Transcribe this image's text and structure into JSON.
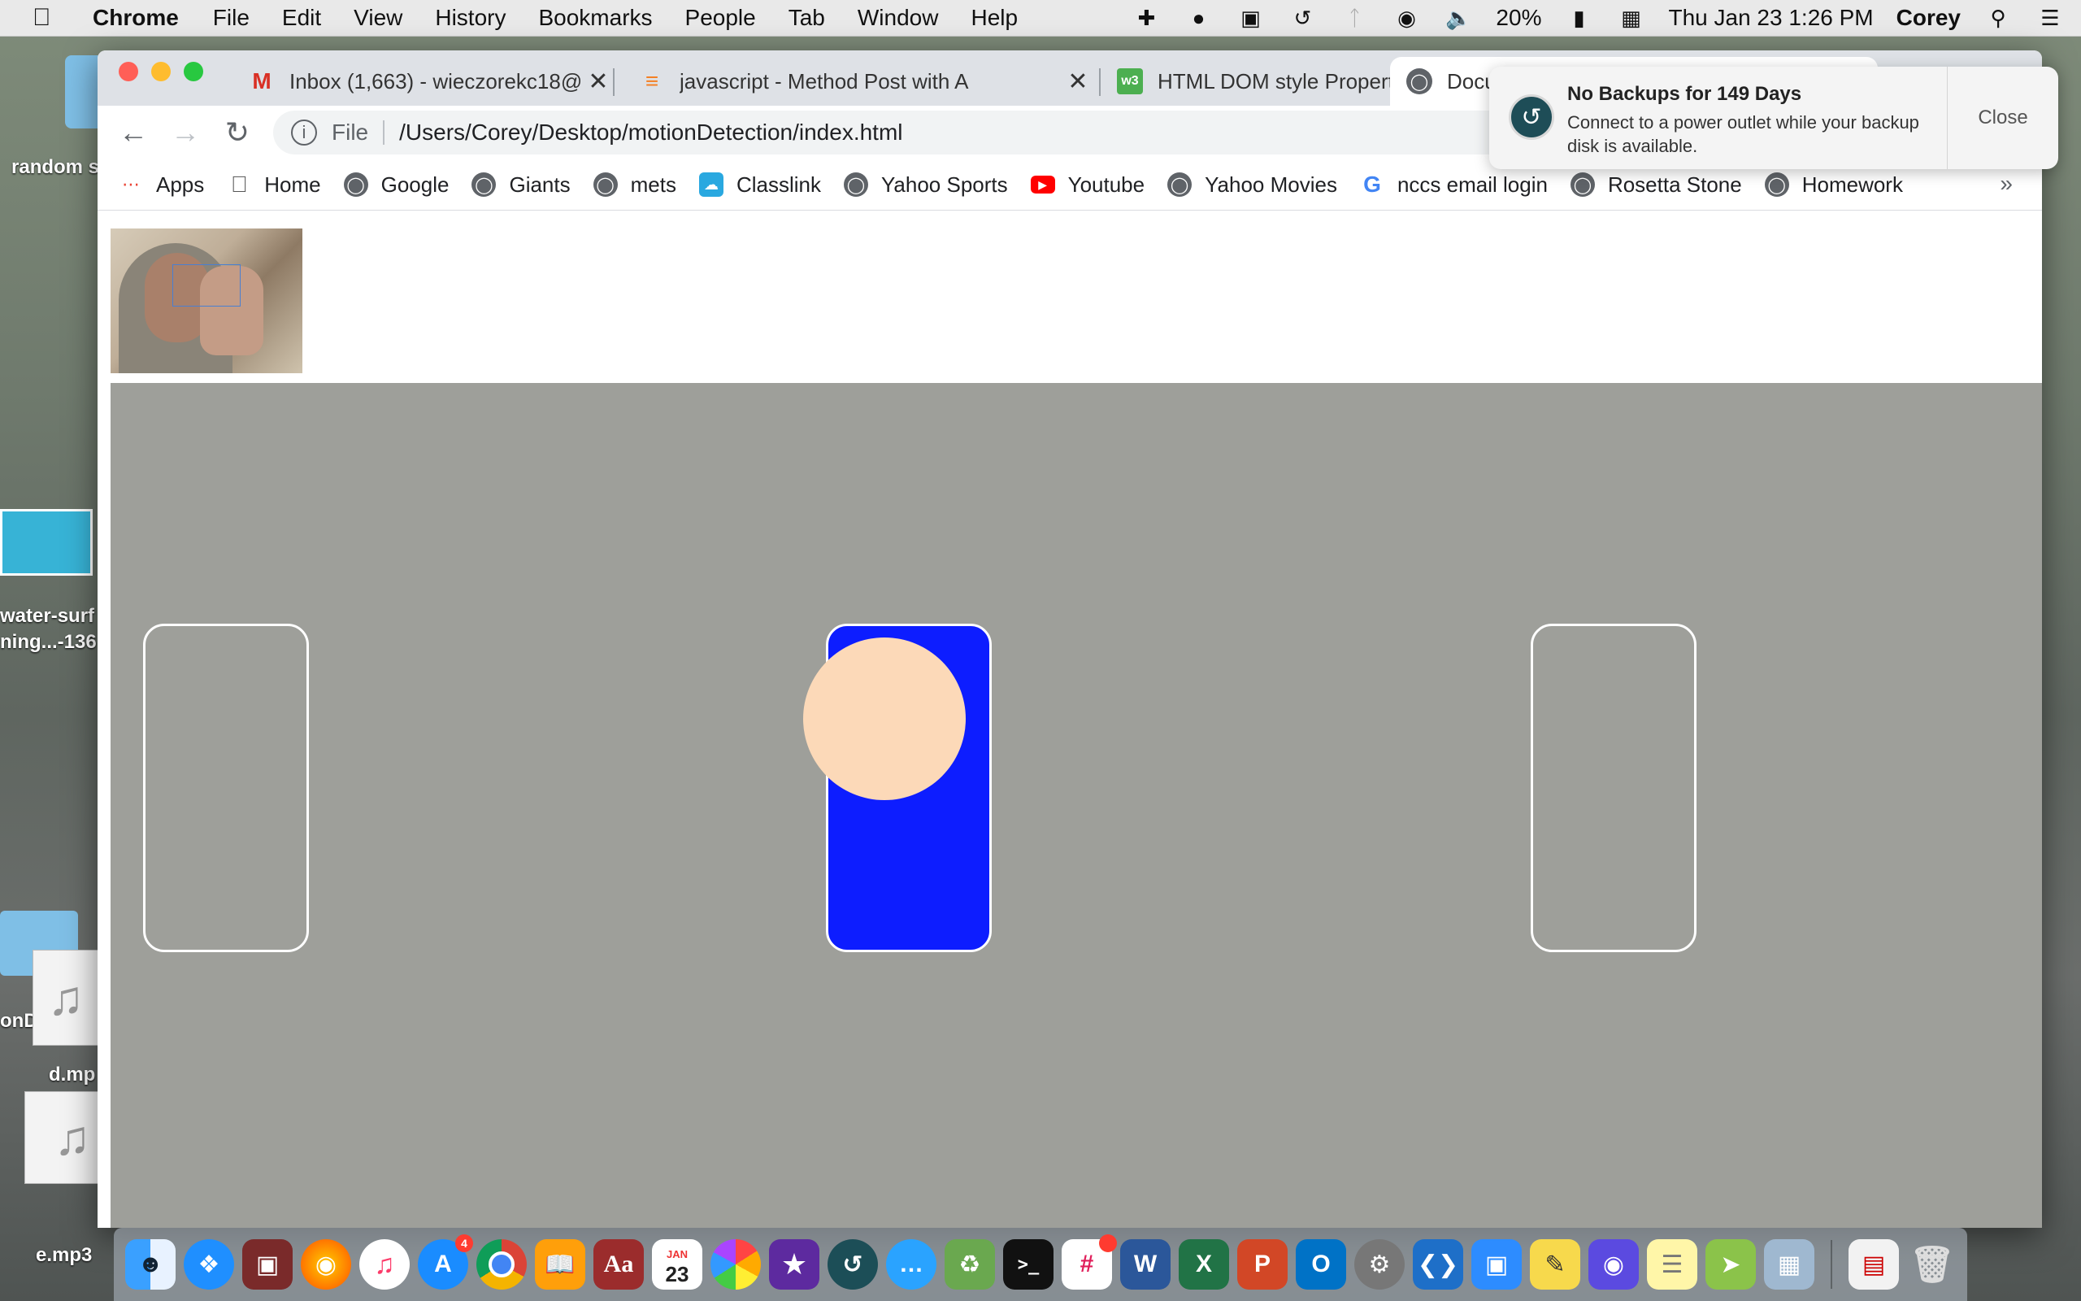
{
  "menubar": {
    "app_name": "Chrome",
    "menus": [
      "File",
      "Edit",
      "View",
      "History",
      "Bookmarks",
      "People",
      "Tab",
      "Window",
      "Help"
    ],
    "battery": "20%",
    "datetime": "Thu Jan 23  1:26 PM",
    "user": "Corey"
  },
  "desktop": {
    "labels": [
      "random s",
      "water-surf",
      "ning...-136",
      "onD",
      "d.mp",
      "e.mp3"
    ]
  },
  "tabs": [
    {
      "title": "Inbox (1,663) - wieczorekc18@",
      "icon": "gmail-icon"
    },
    {
      "title": "javascript - Method Post with A",
      "icon": "stackoverflow-icon"
    },
    {
      "title": "HTML DOM style Property",
      "icon": "w3schools-icon"
    },
    {
      "title": "Docu",
      "icon": "globe-icon"
    }
  ],
  "toolbar": {
    "scheme": "File",
    "url": "/Users/Corey/Desktop/motionDetection/index.html"
  },
  "bookmarks": [
    "Apps",
    "Home",
    "Google",
    "Giants",
    "mets",
    "Classlink",
    "Yahoo Sports",
    "Youtube",
    "Yahoo Movies",
    "nccs email login",
    "Rosetta Stone",
    "Homework"
  ],
  "bookmarks_more": "»",
  "notification": {
    "title": "No Backups for 149 Days",
    "body": "Connect to a power outlet while your backup disk is available.",
    "close_label": "Close"
  },
  "game": {
    "background": "#9e9f9a",
    "active_zone_color": "#0d1dff",
    "ball_color": "#fcd9b8"
  },
  "dock": {
    "appstore_badge": "4",
    "calendar_month": "JAN",
    "calendar_day": "23",
    "dictionary_label": "Aa",
    "word_label": "W",
    "excel_label": "X",
    "powerpoint_label": "P",
    "outlook_label": "O"
  }
}
